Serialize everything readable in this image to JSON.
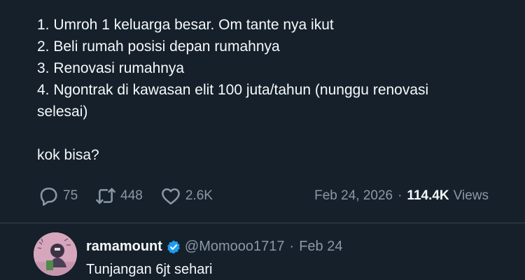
{
  "post": {
    "lines": [
      "1. Umroh 1 keluarga besar. Om tante nya ikut",
      "2. Beli rumah posisi depan rumahnya",
      "3. Renovasi rumahnya",
      "4. Ngontrak di kawasan elit 100 juta/tahun (nunggu renovasi",
      "selesai)",
      "kok bisa?"
    ],
    "replies_count": "75",
    "reposts_count": "448",
    "likes_count": "2.6K",
    "date": "Feb 24, 2026",
    "separator": "·",
    "views_count": "114.4K",
    "views_label": "Views"
  },
  "reply": {
    "display_name": "ramamount",
    "handle": "@Momooo1717",
    "separator": "·",
    "date": "Feb 24",
    "text": "Tunjangan 6jt sehari"
  },
  "icons": {
    "reply": "speech-bubble-icon",
    "repost": "repost-arrows-icon",
    "like": "heart-icon",
    "verified": "verified-badge-icon"
  },
  "colors": {
    "background": "#15202b",
    "text_primary": "#f7f9f9",
    "text_secondary": "#8b98a5",
    "divider": "#38444d",
    "verified_blue": "#1d9bf0"
  }
}
